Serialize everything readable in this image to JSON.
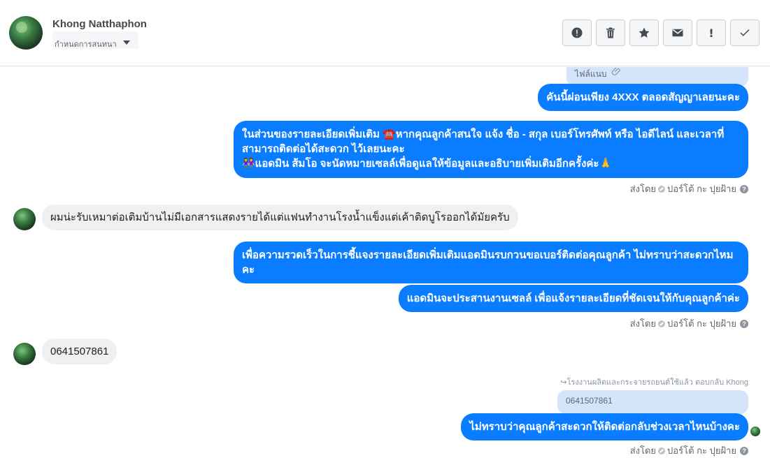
{
  "header": {
    "name": "Khong Natthaphon",
    "assign_label": "กำหนดการสนทนา",
    "toolbar": [
      "mark-spam",
      "delete",
      "star",
      "mark-unread",
      "important",
      "done"
    ]
  },
  "messages": {
    "attachment_label": "ไฟล์แนบ",
    "m1": "คันนี้ผ่อนเพียง 4XXX  ตลอดสัญญาเลยนะคะ",
    "m2_line1": "ในส่วนของรายละเอียดเพิ่มเติม  ☎️หากคุณลูกค้าสนใจ แจ้ง ชื่อ - สกุล เบอร์โทรศัพท์ หรือ ไอดีไลน์ และเวลาที่",
    "m2_line2": "สามารถติดต่อได้สะดวก ไว้เลยนะคะ",
    "m2_line3": "👭แอดมิน ส้มโอ จะนัดหมายเซลล์เพื่อดูแลให้ข้อมูลและอธิบายเพิ่มเติมอีกครั้งค่ะ🙏",
    "sent_by_1_prefix": "ส่งโดย",
    "sent_by_1_name": "ปอร์โต้ กะ ปุยฝ้าย",
    "in1": "ผมน่ะรับเหมาต่อเติมบ้านไม่มีเอกสารแสดงรายได้แต่แฟนทำงานโรงน้ำแข็งแต่เค้าติดบูโรออกได้มัยครับ",
    "m3_line1": "เพื่อความรวดเร็วในการชี้แจงรายละเอียดเพิ่มเติมแอดมินรบกวนขอเบอร์ติดต่อคุณลูกค้า ไม่ทราบว่าสะดวกไหม",
    "m3_line2": "คะ",
    "m4": "แอดมินจะประสานงานเซลล์ เพื่อแจ้งรายละเอียดที่ชัดเจนให้กับคุณลูกค้าค่ะ",
    "sent_by_2_prefix": "ส่งโดย",
    "sent_by_2_name": "ปอร์โต้ กะ ปุยฝ้าย",
    "in2": "0641507861",
    "reply_note": "↪โรงงานผลิตและกระจายรถยนต์ใช้แล้ว ตอบกลับ Khong",
    "quoted": "0641507861",
    "m5": "ไม่ทราบว่าคุณลูกค้าสะดวกให้ติดต่อกลับช่วงเวลาไหนบ้างคะ",
    "sent_by_3_prefix": "ส่งโดย",
    "sent_by_3_name": "ปอร์โต้ กะ ปุยฝ้าย"
  },
  "colors": {
    "outgoing": "#0a7cff",
    "incoming": "#f0f0f0",
    "quote": "#d3e4fb"
  }
}
